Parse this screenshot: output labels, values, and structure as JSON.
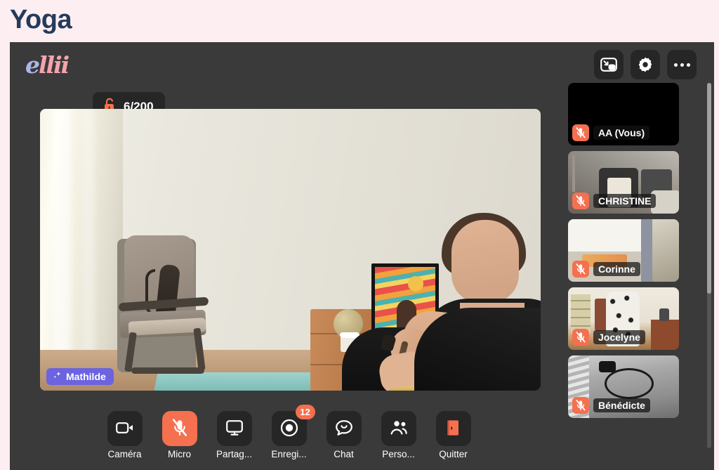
{
  "page": {
    "title": "Yoga",
    "title_color": "#253b5c",
    "background_color": "#fdeef1"
  },
  "meeting": {
    "background_color": "#3a3a3a",
    "accent_color": "#f4704f",
    "speaker_badge_color": "#6c63e0",
    "brand": {
      "name": "ellii",
      "logo_first_letter": "e",
      "logo_rest": "llii",
      "logo_first_color": "#aab8e8",
      "logo_rest_color": "#f5a3ad"
    },
    "capacity": {
      "icon": "unlock-icon",
      "label": "6/200"
    },
    "top_actions": [
      {
        "name": "picture-in-picture-button",
        "icon": "picture-in-picture-icon"
      },
      {
        "name": "settings-button",
        "icon": "gear-icon"
      },
      {
        "name": "more-options-button",
        "icon": "ellipsis-icon"
      }
    ],
    "stage": {
      "speaker_name": "Mathilde",
      "speaker_badge_icon": "sparkle-icon"
    },
    "participants": [
      {
        "name": "AA (Vous)",
        "muted": true,
        "camera_on": false,
        "mic_icon": "mic-off-icon"
      },
      {
        "name": "CHRISTINE",
        "muted": true,
        "camera_on": true,
        "mic_icon": "mic-off-icon"
      },
      {
        "name": "Corinne",
        "muted": true,
        "camera_on": true,
        "mic_icon": "mic-off-icon"
      },
      {
        "name": "Jocelyne",
        "muted": true,
        "camera_on": true,
        "mic_icon": "mic-off-icon"
      },
      {
        "name": "Bénédicte",
        "muted": true,
        "camera_on": true,
        "mic_icon": "mic-off-icon"
      }
    ],
    "toolbar": [
      {
        "label": "Caméra",
        "icon": "video-camera-icon",
        "active": false,
        "badge": null
      },
      {
        "label": "Micro",
        "icon": "mic-off-icon",
        "active": true,
        "badge": null
      },
      {
        "label": "Partag...",
        "icon": "screen-share-icon",
        "active": false,
        "badge": null
      },
      {
        "label": "Enregi...",
        "icon": "record-icon",
        "active": false,
        "badge": "12"
      },
      {
        "label": "Chat",
        "icon": "chat-bubble-icon",
        "active": false,
        "badge": null
      },
      {
        "label": "Perso...",
        "icon": "people-icon",
        "active": false,
        "badge": null
      },
      {
        "label": "Quitter",
        "icon": "leave-door-icon",
        "active": false,
        "badge": null
      }
    ]
  }
}
